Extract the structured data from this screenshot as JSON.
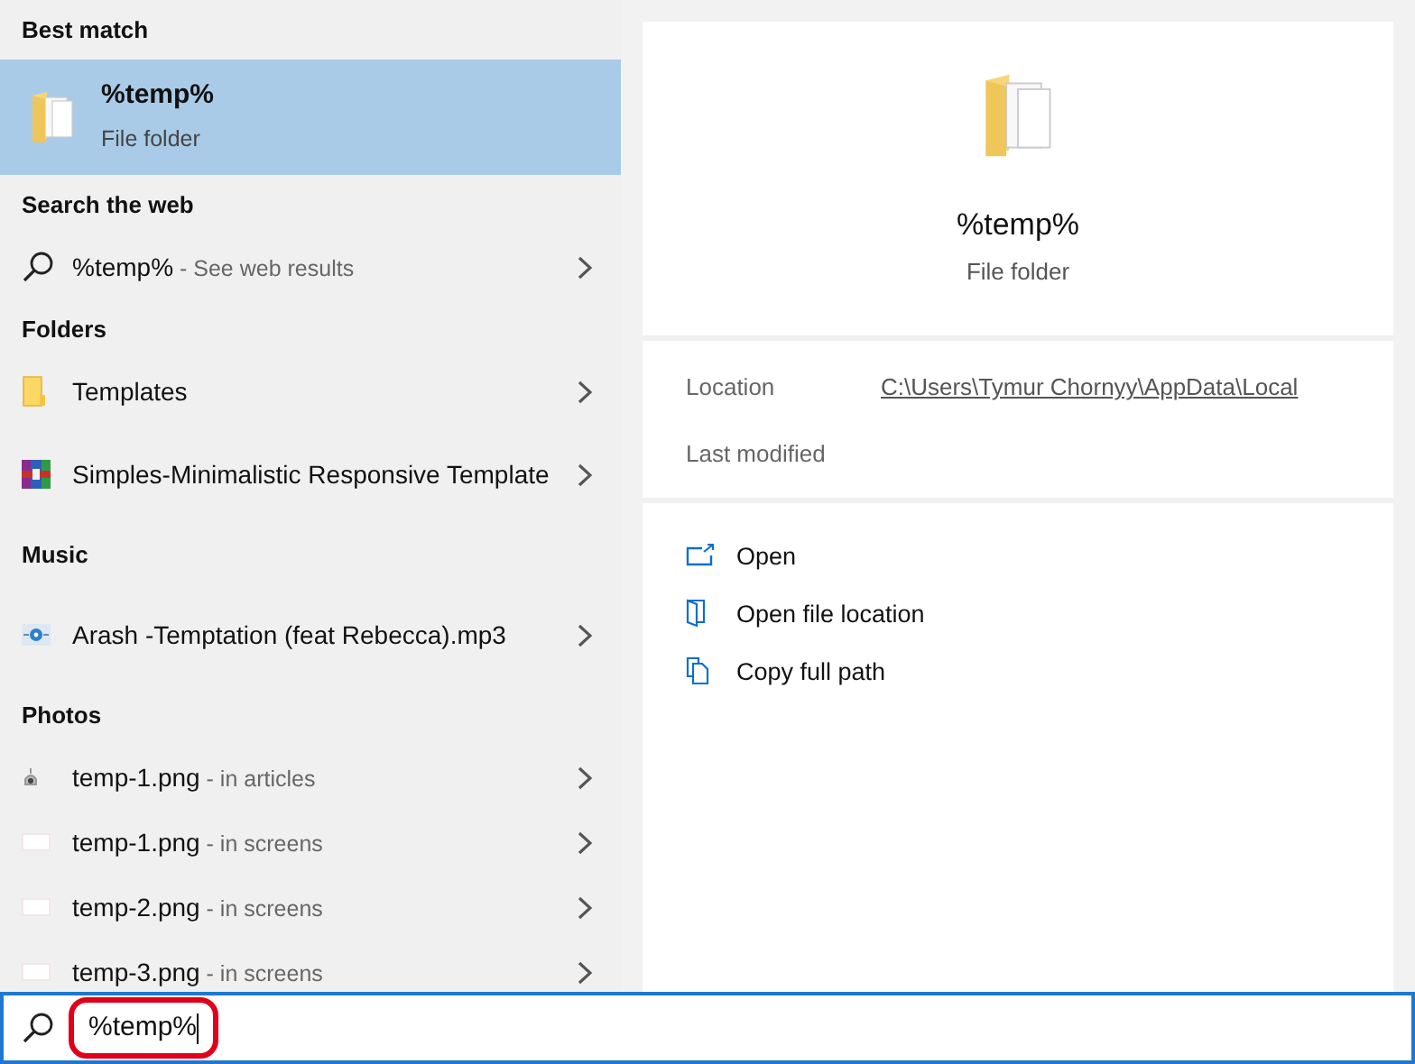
{
  "results": {
    "sections": [
      {
        "title": "Best match",
        "items": [
          {
            "kind": "folder-large",
            "name": "%temp%",
            "detail": "File folder",
            "selected": true
          }
        ]
      },
      {
        "title": "Search the web",
        "items": [
          {
            "kind": "web",
            "name": "%temp%",
            "suffix": "- See web results",
            "selected": false
          }
        ]
      },
      {
        "title": "Folders",
        "items": [
          {
            "kind": "folder",
            "name": "Templates",
            "selected": false
          },
          {
            "kind": "archive",
            "name": "Simples-Minimalistic Responsive Template",
            "selected": false
          }
        ]
      },
      {
        "title": "Music",
        "items": [
          {
            "kind": "audio",
            "name": "Arash -Temptation (feat Rebecca).mp3",
            "selected": false
          }
        ]
      },
      {
        "title": "Photos",
        "items": [
          {
            "kind": "photo",
            "name": "temp-1.png",
            "suffix": "- in articles",
            "selected": false
          },
          {
            "kind": "blank-photo",
            "name": "temp-1.png",
            "suffix": "- in screens",
            "selected": false
          },
          {
            "kind": "blank-photo",
            "name": "temp-2.png",
            "suffix": "- in screens",
            "selected": false
          },
          {
            "kind": "blank-photo",
            "name": "temp-3.png",
            "suffix": "- in screens",
            "selected": false
          }
        ]
      }
    ]
  },
  "preview": {
    "title": "%temp%",
    "subtitle": "File folder",
    "details": [
      {
        "label": "Location",
        "value": "C:\\Users\\Tymur Chornyy\\AppData\\Local"
      },
      {
        "label": "Last modified"
      }
    ],
    "actions": [
      {
        "kind": "open",
        "label": "Open"
      },
      {
        "kind": "location",
        "label": "Open file location"
      },
      {
        "kind": "copy",
        "label": "Copy full path"
      }
    ]
  },
  "search": {
    "value": "%temp%",
    "highlighted": true
  }
}
